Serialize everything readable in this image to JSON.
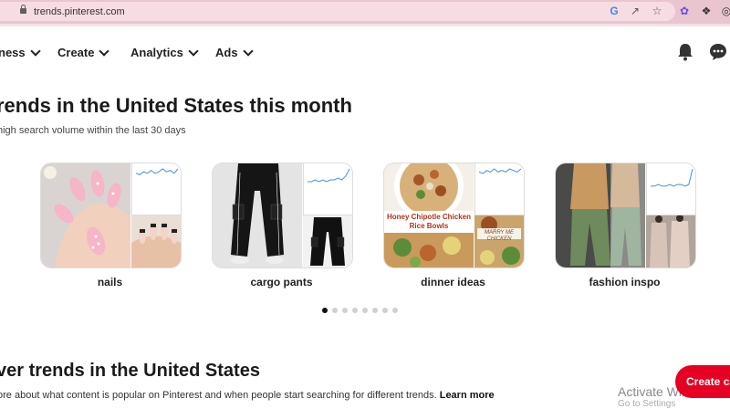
{
  "browser": {
    "url": "trends.pinterest.com",
    "icons": [
      "lock-icon",
      "google-icon",
      "share-icon",
      "star-icon",
      "extension-flower-icon",
      "puzzle-icon",
      "profile-icon"
    ]
  },
  "nav": {
    "items": [
      {
        "label": "ness"
      },
      {
        "label": "Create"
      },
      {
        "label": "Analytics"
      },
      {
        "label": "Ads"
      }
    ]
  },
  "trends": {
    "title": "rends in the United States this month",
    "subtitle": " high search volume within the last 30 days",
    "cards": [
      {
        "label": "nails",
        "sparkline": [
          12,
          11,
          13,
          12,
          14,
          12,
          13,
          15,
          13,
          14,
          12,
          15
        ]
      },
      {
        "label": "cargo pants",
        "sparkline": [
          5,
          5,
          6,
          5,
          6,
          5,
          6,
          6,
          7,
          6,
          8,
          12
        ]
      },
      {
        "label": "dinner ideas",
        "sparkline": [
          12,
          11,
          13,
          12,
          14,
          12,
          13,
          12,
          14,
          13,
          12,
          14
        ],
        "dish_title": "Honey Chipotle Chicken Rice Bowls",
        "dish_tag": "MARRY ME CHICKEN"
      },
      {
        "label": "fashion inspo",
        "sparkline": [
          3,
          3,
          4,
          3,
          3,
          4,
          3,
          4,
          4,
          3,
          4,
          14
        ]
      }
    ],
    "pagination": {
      "count": 8,
      "active": 0
    }
  },
  "discover": {
    "title": "ver trends in the United States",
    "subtitle": "ore about what content is popular on Pinterest and when people start searching for different trends.",
    "learn_more": "Learn more"
  },
  "create_button": "Create ca",
  "watermark": {
    "line1": "Activate Windows",
    "line2": "Go to Settings"
  },
  "colors": {
    "accent": "#e60023",
    "chrome": "#e9c6cf",
    "sparkline": "#4a90d9"
  }
}
